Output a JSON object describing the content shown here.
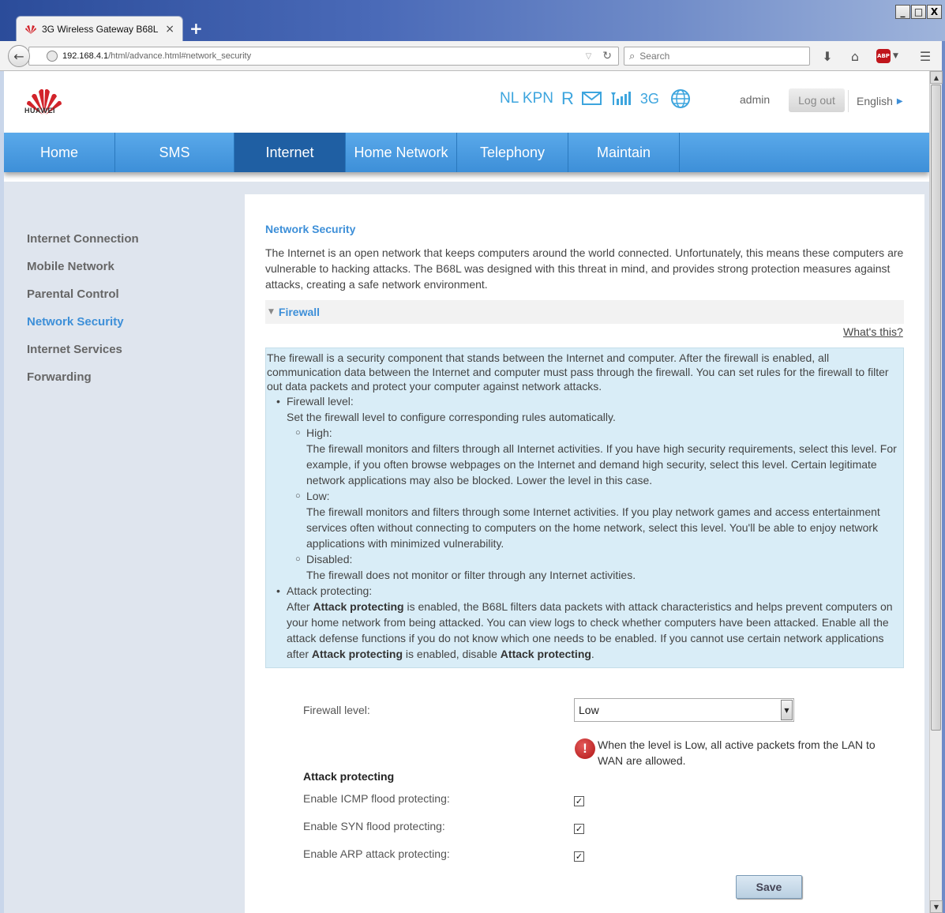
{
  "browser": {
    "tab_title": "3G Wireless Gateway B68L",
    "tab_close": "×",
    "new_tab": "+",
    "url_host": "192.168.4.1",
    "url_path": "/html/advance.html#network_security",
    "search_placeholder": "Search",
    "window_buttons": {
      "minimize": "_",
      "maximize": "□",
      "close": "X"
    }
  },
  "header": {
    "logo_text": "HUAWEI",
    "operator": "NL KPN",
    "roaming": "R",
    "network_type": "3G",
    "user": "admin",
    "logout_label": "Log out",
    "language": "English"
  },
  "nav": {
    "items": [
      {
        "label": "Home"
      },
      {
        "label": "SMS"
      },
      {
        "label": "Internet"
      },
      {
        "label": "Home Network"
      },
      {
        "label": "Telephony"
      },
      {
        "label": "Maintain"
      }
    ],
    "active": "Internet"
  },
  "sidebar": {
    "items": [
      {
        "label": "Internet Connection"
      },
      {
        "label": "Mobile Network"
      },
      {
        "label": "Parental Control"
      },
      {
        "label": "Network Security"
      },
      {
        "label": "Internet Services"
      },
      {
        "label": "Forwarding"
      }
    ],
    "active": "Network Security"
  },
  "content": {
    "title": "Network Security",
    "intro": "The Internet is an open network that keeps computers around the world connected. Unfortunately, this means these computers are vulnerable to hacking attacks. The B68L was designed with this threat in mind, and provides strong protection measures against attacks, creating a safe network environment.",
    "section": "Firewall",
    "whats_this": "What's this?",
    "help": {
      "intro": "The firewall is a security component that stands between the Internet and computer. After the firewall is enabled, all communication data between the Internet and computer must pass through the firewall. You can set rules for the firewall to filter out data packets and protect your computer against network attacks.",
      "firewall_level_title": "Firewall level:",
      "firewall_level_desc": "Set the firewall level to configure corresponding rules automatically.",
      "high_title": "High:",
      "high_desc": "The firewall monitors and filters through all Internet activities. If you have high security requirements, select this level. For example, if you often browse webpages on the Internet and demand high security, select this level. Certain legitimate network applications may also be blocked. Lower the level in this case.",
      "low_title": "Low:",
      "low_desc": "The firewall monitors and filters through some Internet activities. If you play network games and access entertainment services often without connecting to computers on the home network, select this level. You'll be able to enjoy network applications with minimized vulnerability.",
      "disabled_title": "Disabled:",
      "disabled_desc": "The firewall does not monitor or filter through any Internet activities.",
      "attack_title": "Attack protecting:",
      "attack_bold": "Attack protecting",
      "attack_desc_1": "After ",
      "attack_desc_2": " is enabled, the B68L filters data packets with attack characteristics and helps prevent computers on your home network from being attacked. You can view logs to check whether computers have been attacked. Enable all the attack defense functions if you do not know which one needs to be enabled. If you cannot use certain network applications after ",
      "attack_desc_3": " is enabled, disable ",
      "attack_desc_4": "."
    },
    "form": {
      "firewall_level_label": "Firewall level:",
      "firewall_level_value": "Low",
      "warning": "When the level is Low, all active packets from the LAN to WAN are allowed.",
      "attack_heading": "Attack protecting",
      "icmp_label": "Enable ICMP flood protecting:",
      "icmp_checked": true,
      "syn_label": "Enable SYN flood protecting:",
      "syn_checked": true,
      "arp_label": "Enable ARP attack protecting:",
      "arp_checked": true,
      "save_label": "Save"
    }
  },
  "colors": {
    "accent": "#3d8fd8",
    "nav_active": "#1f5fa3",
    "help_bg": "#d9edf7",
    "sidebar_bg": "#dfe5ee",
    "warning": "#c0161c"
  }
}
